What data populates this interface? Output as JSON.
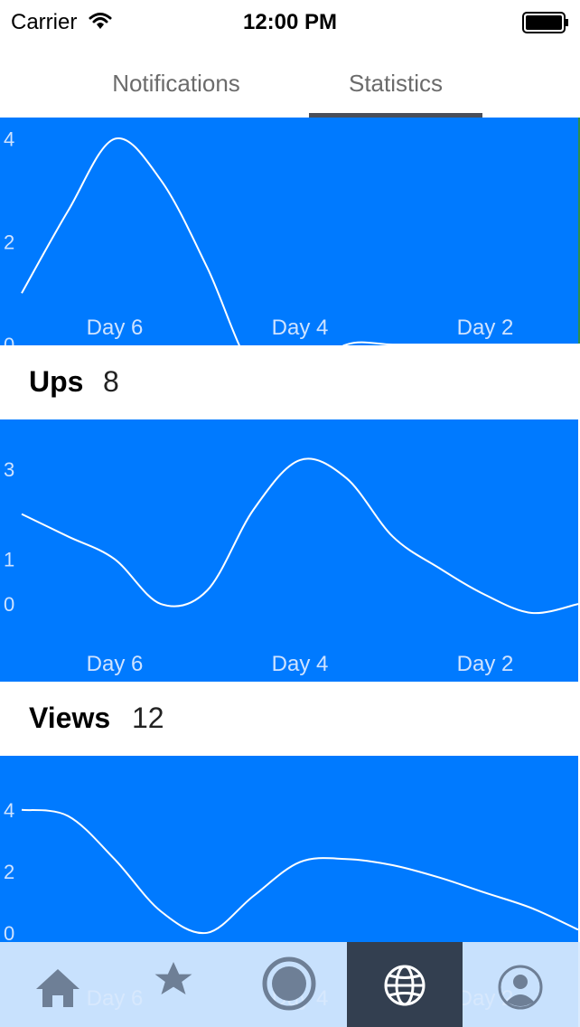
{
  "status_bar": {
    "carrier": "Carrier",
    "time": "12:00 PM"
  },
  "tabs": [
    {
      "label": "Notifications",
      "selected": false
    },
    {
      "label": "Statistics",
      "selected": true
    }
  ],
  "colors": {
    "chart_bg": "#007aff",
    "line": "#ffffff",
    "tab_active_bg": "#333f50",
    "tab_bar_bg": "#d7e8fd",
    "icon": "#6e7f96"
  },
  "sections": [
    {
      "title": "Ups",
      "count": "8"
    },
    {
      "title": "Views",
      "count": "12"
    }
  ],
  "tab_bar": {
    "items": [
      {
        "icon": "home-icon",
        "selected": false
      },
      {
        "icon": "star-icon",
        "selected": false
      },
      {
        "icon": "circle-icon",
        "selected": false
      },
      {
        "icon": "globe-icon",
        "selected": true
      },
      {
        "icon": "profile-icon",
        "selected": false
      }
    ]
  },
  "chart_data": [
    {
      "type": "line",
      "x_ticks": [
        "Day 6",
        "Day 4",
        "Day 2"
      ],
      "y_ticks": [
        0,
        2,
        4
      ],
      "ylim": [
        -1,
        4.1
      ],
      "series": [
        {
          "x": [
            0,
            0.5,
            1,
            1.5,
            2,
            2.5,
            3,
            3.5,
            4,
            4.5,
            5,
            5.5,
            6
          ],
          "y": [
            1,
            2.6,
            4,
            3.2,
            1.5,
            -0.5,
            -0.6,
            0,
            0,
            0,
            0,
            0,
            0
          ]
        }
      ]
    },
    {
      "type": "line",
      "x_ticks": [
        "Day 6",
        "Day 4",
        "Day 2"
      ],
      "y_ticks": [
        0,
        1,
        3
      ],
      "ylim": [
        -0.2,
        3.5
      ],
      "series": [
        {
          "x": [
            0,
            0.5,
            1,
            1.5,
            2,
            2.5,
            3,
            3.5,
            4,
            4.5,
            5,
            5.5,
            6
          ],
          "y": [
            2,
            1.5,
            1,
            0,
            0.3,
            2.1,
            3.2,
            2.8,
            1.5,
            0.8,
            0.2,
            -0.2,
            0
          ]
        }
      ]
    },
    {
      "type": "line",
      "x_ticks": [
        "Day 6",
        "Day 4",
        "Day 2"
      ],
      "y_ticks": [
        0,
        2,
        4
      ],
      "ylim": [
        -0.3,
        4.7
      ],
      "series": [
        {
          "x": [
            0,
            0.5,
            1,
            1.5,
            2,
            2.5,
            3,
            3.5,
            4,
            4.5,
            5,
            5.5,
            6
          ],
          "y": [
            4,
            3.8,
            2.4,
            0.7,
            0,
            1.2,
            2.3,
            2.4,
            2.2,
            1.8,
            1.3,
            0.8,
            0.1
          ]
        }
      ]
    }
  ]
}
